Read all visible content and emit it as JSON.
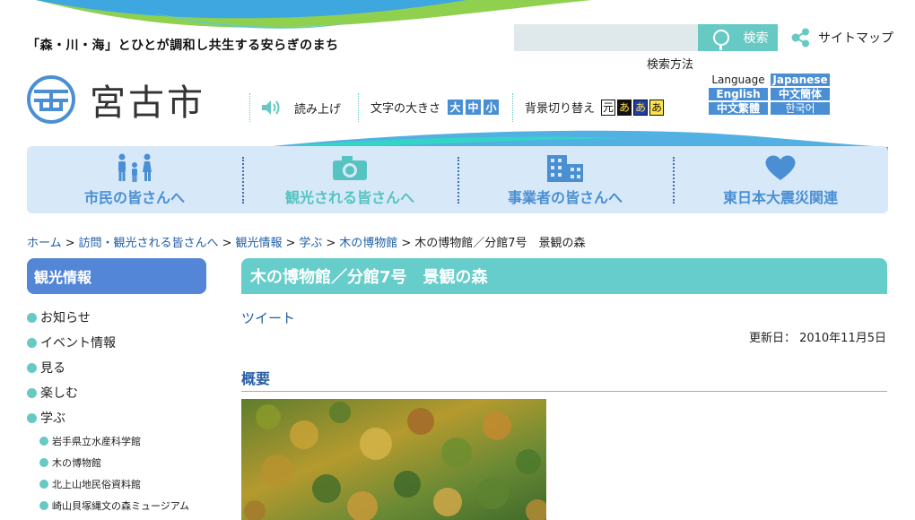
{
  "header": {
    "tagline": "「森・川・海」とひとが調和し共生する安らぎのまち",
    "logo_text": "宮古市",
    "search": {
      "placeholder": "",
      "button_label": "検索",
      "method_label": "検索方法"
    },
    "sitemap_label": "サイトマップ"
  },
  "toolbar": {
    "read_aloud": "読み上げ",
    "text_size_label": "文字の大きさ",
    "sizes": [
      "大",
      "中",
      "小"
    ],
    "bg_label": "背景切り替え",
    "bg_options": [
      "元",
      "あ",
      "あ",
      "あ"
    ]
  },
  "language": {
    "label": "Language",
    "options": [
      "Japanese",
      "English",
      "中文簡体",
      "中文繁體",
      "한국어"
    ]
  },
  "nav": {
    "items": [
      {
        "label": "市民の皆さんへ",
        "color": "#4a8fd4"
      },
      {
        "label": "観光される皆さんへ",
        "color": "#57c3c0"
      },
      {
        "label": "事業者の皆さんへ",
        "color": "#4a8fd4"
      },
      {
        "label": "東日本大震災関連",
        "color": "#4a8fd4"
      }
    ]
  },
  "breadcrumb": {
    "links": [
      "ホーム",
      "訪問・観光される皆さんへ",
      "観光情報",
      "学ぶ",
      "木の博物館"
    ],
    "current": "木の博物館／分館7号　景観の森",
    "separator": ">"
  },
  "sidebar": {
    "title": "観光情報",
    "items": [
      "お知らせ",
      "イベント情報",
      "見る",
      "楽しむ",
      "学ぶ"
    ],
    "subitems": [
      "岩手県立水産科学館",
      "木の博物館",
      "北上山地民俗資料館",
      "崎山貝塚縄文の森ミュージアム"
    ]
  },
  "content": {
    "title": "木の博物館／分館7号　景観の森",
    "tweet": "ツイート",
    "updated": "更新日： 2010年11月5日",
    "section_heading": "概要"
  },
  "colors": {
    "accent_teal": "#66c9c4",
    "accent_blue": "#4a8fd4",
    "nav_bg": "#d7e9f8",
    "sidebar_title_bg": "#5386d6"
  }
}
